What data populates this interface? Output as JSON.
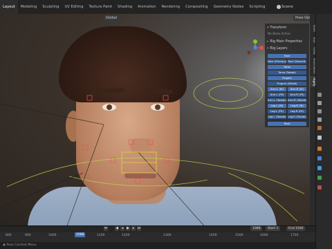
{
  "topbar": {
    "tabs": [
      "Layout",
      "Modeling",
      "Sculpting",
      "UV Editing",
      "Texture Paint",
      "Shading",
      "Animation",
      "Rendering",
      "Compositing",
      "Geometry Nodes",
      "Scripting"
    ],
    "active_tab": "Layout",
    "scene_label": "Scene"
  },
  "viewport": {
    "mode_label": "Global",
    "pose_options_label": "Pose Options"
  },
  "npanel": {
    "transform_label": "Transform",
    "transform_hint": "No Bone Active",
    "rig_main_label": "Rig Main Properties",
    "rig_layers_label": "Rig Layers",
    "buttons": [
      "Face",
      "Face (Primary)",
      "Face (Second...",
      "Torso",
      "Torso (Tweak)",
      "Fingers",
      "Fingers (Detail)",
      "Arm.L (IK)",
      "Arm.R (IK)",
      "Arm.L (FK)",
      "Arm.R (FK)",
      "Arm.L (Tweak)",
      "Arm.R (Tweak)",
      "Leg.L (IK)",
      "Leg.R (IK)",
      "Leg.L (FK)",
      "Leg.R (FK)",
      "Leg.L (Tweak)",
      "Leg.R (Tweak)",
      "Root"
    ],
    "side_tabs": [
      "Item",
      "Tool",
      "View",
      "Animation",
      "Rigify"
    ]
  },
  "timeline": {
    "ticks": [
      "800",
      "900",
      "1000",
      "1100",
      "1200",
      "1300",
      "1400",
      "1500",
      "1600",
      "1700"
    ],
    "current_frame": "1088",
    "start_label": "Start",
    "start_value": "1",
    "end_label": "End",
    "end_value": "1500"
  },
  "status": {
    "text": "Pose Context Menu"
  },
  "colors": {
    "accent": "#4772b3",
    "bg": "#1d1d1d"
  }
}
